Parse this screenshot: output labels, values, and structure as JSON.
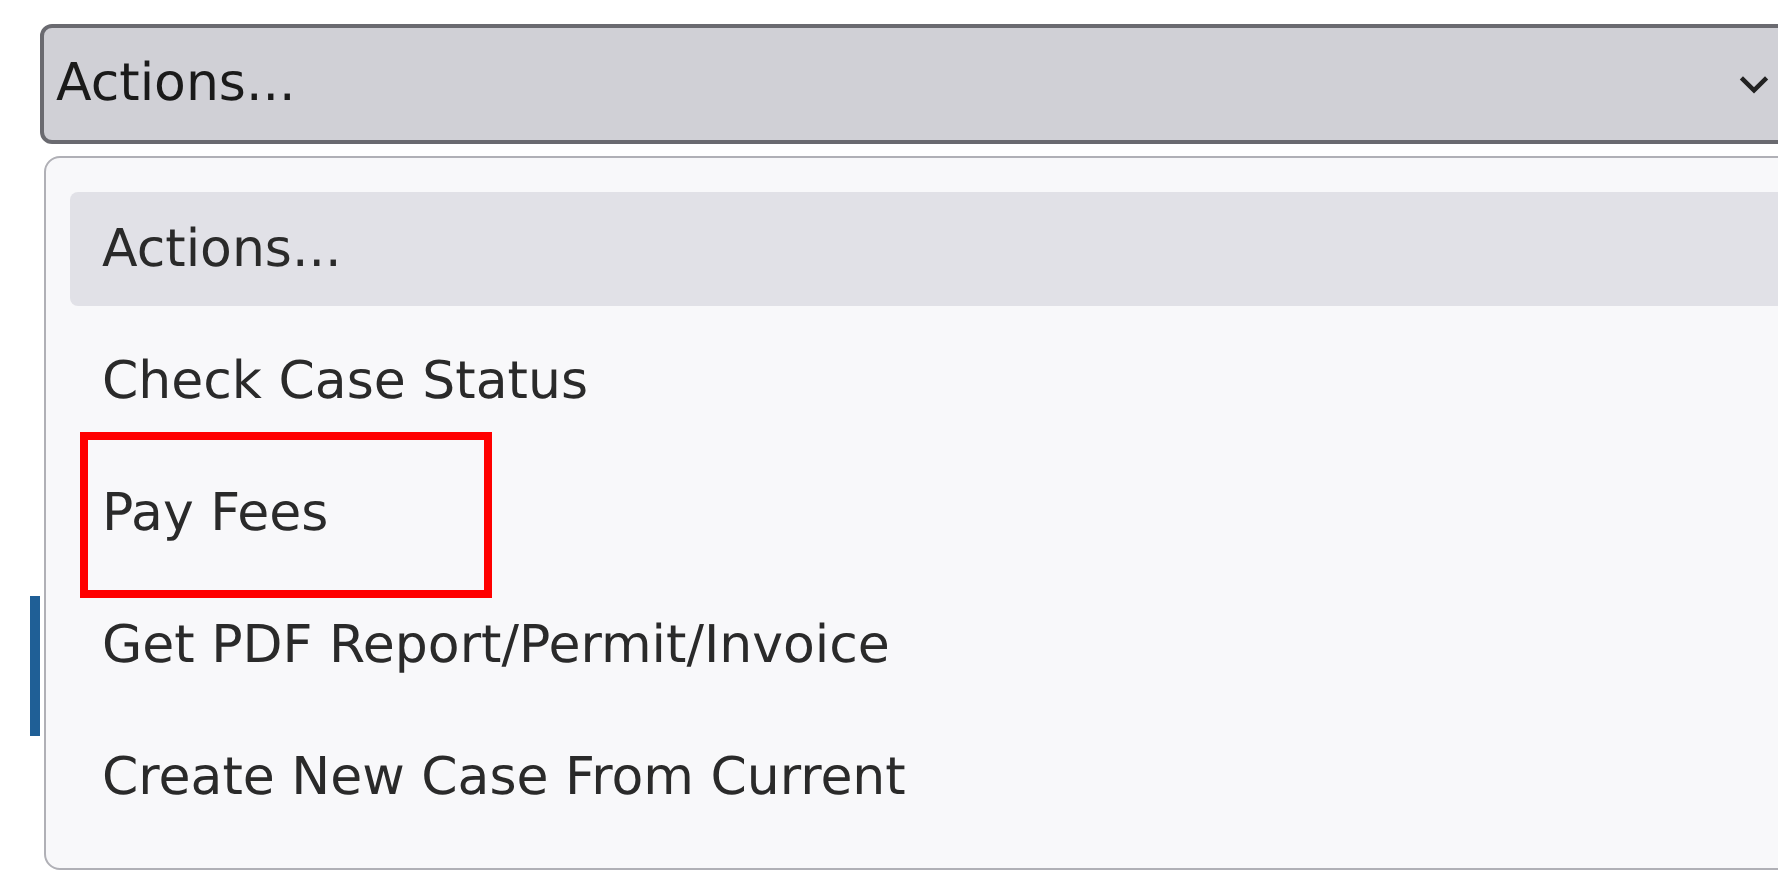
{
  "select": {
    "value": "Actions..."
  },
  "options": [
    {
      "label": "Actions...",
      "selected": true,
      "highlighted": false
    },
    {
      "label": "Check Case Status",
      "selected": false,
      "highlighted": false
    },
    {
      "label": "Pay Fees",
      "selected": false,
      "highlighted": true
    },
    {
      "label": "Get PDF Report/Permit/Invoice",
      "selected": false,
      "highlighted": false
    },
    {
      "label": "Create New Case From Current",
      "selected": false,
      "highlighted": false
    }
  ]
}
